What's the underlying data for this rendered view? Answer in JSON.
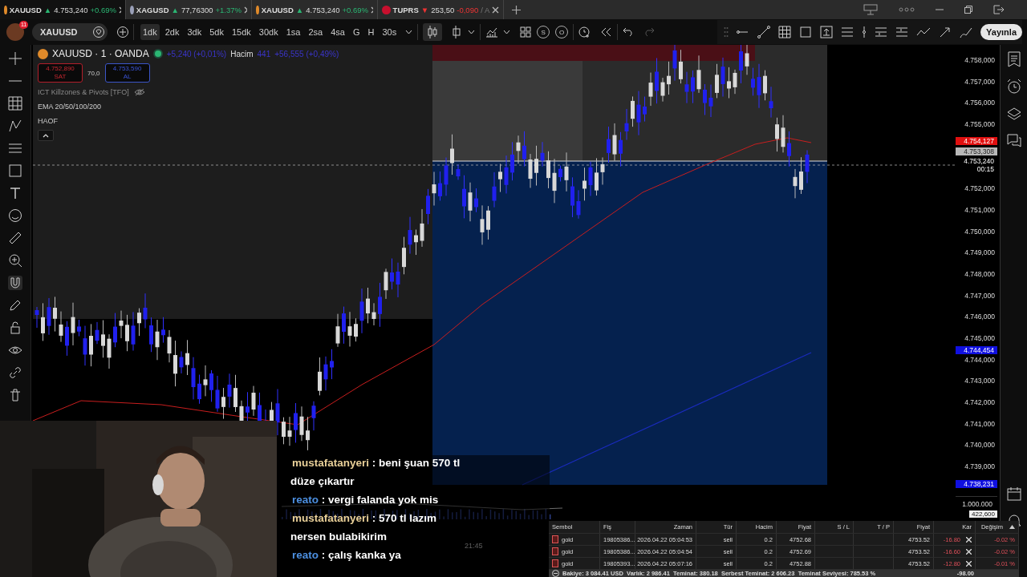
{
  "tabs": [
    {
      "symbol": "XAUUSD",
      "arrow": "▲",
      "kind": "gain",
      "price": "4.753,240",
      "change": "+0.69%",
      "selected": true,
      "color": "#e08a2a"
    },
    {
      "symbol": "XAGUSD",
      "arrow": "▲",
      "kind": "gain",
      "price": "77,76300",
      "change": "+1.37%",
      "selected": false,
      "color": "#9aa0b8"
    },
    {
      "symbol": "XAUUSD",
      "arrow": "▲",
      "kind": "gain",
      "price": "4.753,240",
      "change": "+0.69%",
      "selected": false,
      "color": "#e08a2a"
    },
    {
      "symbol": "TUPRS",
      "arrow": "▼",
      "kind": "loss",
      "price": "253,50",
      "change": "-0,090",
      "extra": "/ A",
      "selected": false,
      "color": "#c8102e"
    }
  ],
  "toolbar": {
    "notifications": "11",
    "symbol": "XAUUSD",
    "intervals": [
      {
        "label": "1dk",
        "selected": true
      },
      {
        "label": "2dk",
        "selected": false
      },
      {
        "label": "3dk",
        "selected": false
      },
      {
        "label": "5dk",
        "selected": false
      },
      {
        "label": "15dk",
        "selected": false
      },
      {
        "label": "30dk",
        "selected": false
      },
      {
        "label": "1sa",
        "selected": false
      },
      {
        "label": "2sa",
        "selected": false
      },
      {
        "label": "4sa",
        "selected": false
      },
      {
        "label": "G",
        "selected": false
      },
      {
        "label": "H",
        "selected": false
      },
      {
        "label": "30s",
        "selected": false
      }
    ],
    "session_buttons": [
      "S",
      "O"
    ],
    "publish": "Yayınla"
  },
  "legend": {
    "title": "XAUUSD · 1 · OANDA",
    "change": "+5,240 (+0,01%)",
    "volume_label": "Hacim",
    "volume": "441",
    "volume_change": "+56,555 (+0,49%)",
    "sell": {
      "price": "4.752,890",
      "label": "SAT"
    },
    "spread": "70,0",
    "buy": {
      "price": "4.753,590",
      "label": "AL"
    },
    "indicators": [
      {
        "name": "ICT Killzones & Pivots [TFO]",
        "hidden": true
      },
      {
        "name": "EMA 20/50/100/200",
        "hidden": false
      },
      {
        "name": "HAOF",
        "hidden": false
      }
    ]
  },
  "price_axis": {
    "ticks": [
      "4.758,000",
      "4.757,000",
      "4.756,000",
      "4.755,000",
      "4.752,000",
      "4.751,000",
      "4.750,000",
      "4.749,000",
      "4.748,000",
      "4.747,000",
      "4.746,000",
      "4.745,000",
      "4.744,000",
      "4.743,000",
      "4.742,000",
      "4.741,000",
      "4.740,000",
      "4.739,000"
    ],
    "tags": [
      {
        "text": "4.754,127",
        "color": "#e01010"
      },
      {
        "text": "4.753,308",
        "color": "#b8b8b8"
      },
      {
        "text": "4.753,240",
        "sub": "00:15",
        "color": "#000000"
      },
      {
        "text": "4.744,454",
        "color": "#1010e0"
      },
      {
        "text": "4.738,231",
        "color": "#1010e0"
      }
    ],
    "volume_tick": "1.000.000",
    "volume_tag": "422,600"
  },
  "time_axis": {
    "label": "21:45"
  },
  "chat": [
    {
      "user": "mustafatanyeri",
      "message": ": beni şuan 570 tl",
      "color": "#e8cf98"
    },
    {
      "text": "düze çıkartır"
    },
    {
      "user": "reato",
      "message": ": vergi falanda yok mis",
      "color": "#4c8fe0"
    },
    {
      "user": "mustafatanyeri",
      "message": ": 570 tl lazım",
      "color": "#e8cf98"
    },
    {
      "text": "nersen bulabikirim"
    },
    {
      "user": "reato",
      "message": ": çalış kanka ya",
      "color": "#4c8fe0"
    }
  ],
  "positions": {
    "columns": [
      "Sembol",
      "Fiş",
      "Zaman",
      "Tür",
      "Hacim",
      "Fiyat",
      "S / L",
      "T / P",
      "Fiyat",
      "Kar",
      "Değişim"
    ],
    "rows": [
      [
        "gold",
        "19805386...",
        "2026.04.22 05:04:53",
        "sell",
        "0.2",
        "4752.68",
        "",
        "",
        "4753.52",
        "-16.80",
        "-0.02 %"
      ],
      [
        "gold",
        "19805386...",
        "2026.04.22 05:04:54",
        "sell",
        "0.2",
        "4752.69",
        "",
        "",
        "4753.52",
        "-16.60",
        "-0.02 %"
      ],
      [
        "gold",
        "19805393...",
        "2026.04.22 05:07:16",
        "sell",
        "0.2",
        "4752.88",
        "",
        "",
        "4753.52",
        "-12.80",
        "-0.01 %"
      ]
    ],
    "summary": "Bakiye: 3 084.41 USD  Varlık: 2 986.41  Teminat: 380.18  Serbest Teminat: 2 606.23  Teminat Seviyesi: 785.53 %",
    "total": "-98.00"
  }
}
